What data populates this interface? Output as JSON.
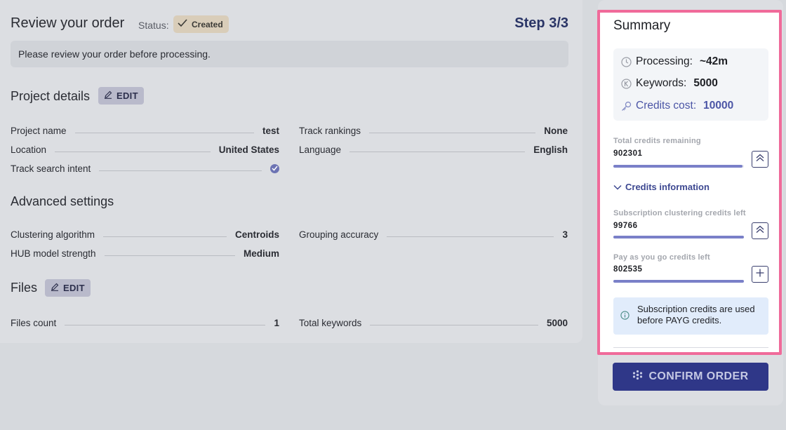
{
  "header": {
    "title": "Review your order",
    "status_label": "Status:",
    "status_badge": "Created",
    "step": "Step 3/3"
  },
  "info_message": "Please review your order before processing.",
  "project_details": {
    "title": "Project details",
    "edit_label": "EDIT",
    "rows": [
      {
        "label": "Project name",
        "value": "test"
      },
      {
        "label": "Track rankings",
        "value": "None"
      },
      {
        "label": "Location",
        "value": "United States"
      },
      {
        "label": "Language",
        "value": "English"
      },
      {
        "label": "Track search intent",
        "value": ""
      }
    ]
  },
  "advanced_settings": {
    "title": "Advanced settings",
    "rows": [
      {
        "label": "Clustering algorithm",
        "value": "Centroids"
      },
      {
        "label": "Grouping accuracy",
        "value": "3"
      },
      {
        "label": "HUB model strength",
        "value": "Medium"
      }
    ]
  },
  "files": {
    "title": "Files",
    "edit_label": "EDIT",
    "rows": [
      {
        "label": "Files count",
        "value": "1"
      },
      {
        "label": "Total keywords",
        "value": "5000"
      }
    ]
  },
  "summary": {
    "title": "Summary",
    "processing_label": "Processing:",
    "processing_value": "~42m",
    "keywords_label": "Keywords:",
    "keywords_value": "5000",
    "cost_label": "Credits cost:",
    "cost_value": "10000",
    "total_label": "Total credits remaining",
    "total_value": "902301",
    "total_fill": 0.99,
    "credits_info_label": "Credits information",
    "subscription_label": "Subscription clustering credits left",
    "subscription_value": "99766",
    "subscription_fill": 1.0,
    "payg_label": "Pay as you go credits left",
    "payg_value": "802535",
    "payg_fill": 1.0,
    "note": "Subscription credits are used before PAYG credits."
  },
  "confirm_label": "CONFIRM ORDER",
  "colors": {
    "accent": "#2f3788",
    "highlight_border": "#f06a9a",
    "bar_fill": "#7a80c8"
  }
}
